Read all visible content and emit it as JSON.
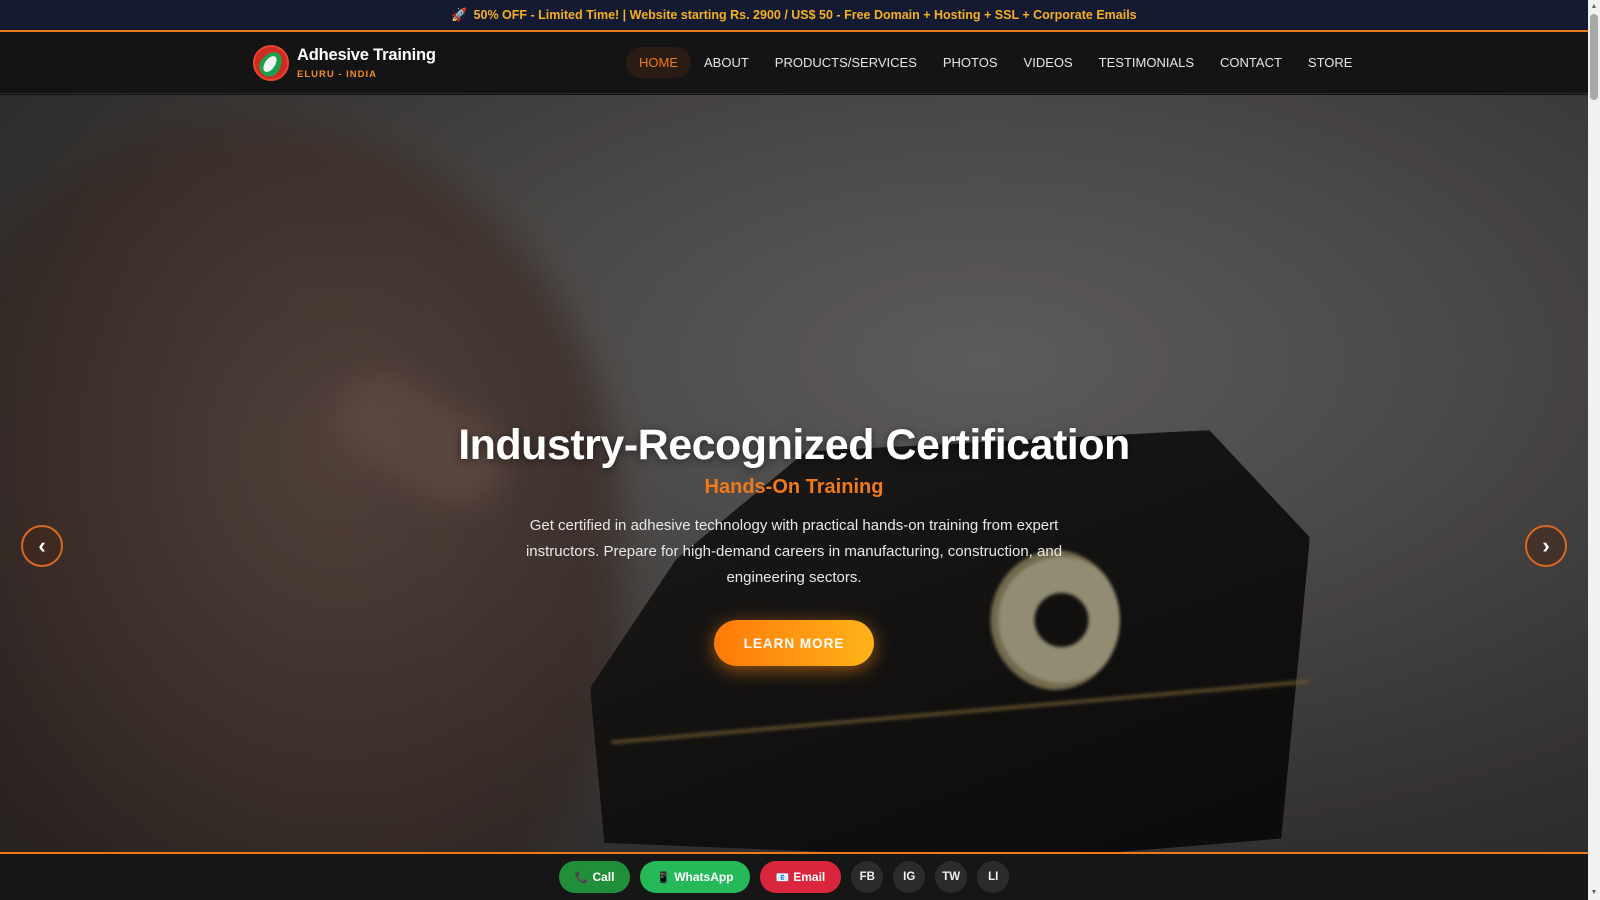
{
  "promo": {
    "icon": "rocket-icon",
    "text": "50% OFF - Limited Time! | Website starting Rs. 2900 / US$ 50 - Free Domain + Hosting + SSL + Corporate Emails"
  },
  "brand": {
    "name": "Adhesive Training",
    "location": "ELURU - INDIA"
  },
  "nav": {
    "items": [
      {
        "label": "HOME",
        "active": true
      },
      {
        "label": "ABOUT"
      },
      {
        "label": "PRODUCTS/SERVICES"
      },
      {
        "label": "PHOTOS"
      },
      {
        "label": "VIDEOS"
      },
      {
        "label": "TESTIMONIALS"
      },
      {
        "label": "CONTACT"
      },
      {
        "label": "STORE"
      }
    ]
  },
  "hero": {
    "title": "Industry-Recognized Certification",
    "subtitle": "Hands-On Training",
    "description": "Get certified in adhesive technology with practical hands-on training from expert instructors. Prepare for high-demand careers in manufacturing, construction, and engineering sectors.",
    "cta_label": "LEARN MORE",
    "prev_label": "‹",
    "next_label": "›"
  },
  "bottom_bar": {
    "call": {
      "label": "Call",
      "icon": "phone-icon"
    },
    "whatsapp": {
      "label": "WhatsApp",
      "icon": "mobile-icon"
    },
    "email": {
      "label": "Email",
      "icon": "mail-icon"
    },
    "social": [
      "FB",
      "IG",
      "TW",
      "LI"
    ]
  },
  "colors": {
    "accent": "#f07a1a",
    "promo_text": "#f5b020",
    "call": "#1f8f3a",
    "whatsapp": "#25b95a",
    "email": "#d9263d"
  }
}
